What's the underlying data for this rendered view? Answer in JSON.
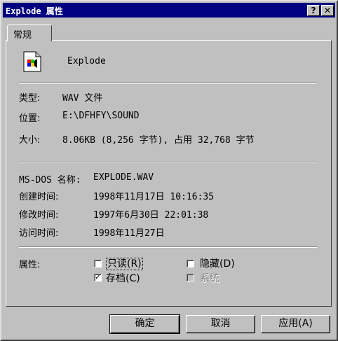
{
  "window": {
    "title": "Explode 属性",
    "help_button": "?",
    "close_button": "✕"
  },
  "tabs": [
    {
      "label": "常规",
      "selected": true
    }
  ],
  "file": {
    "name": "Explode",
    "icon": "sound-file-icon"
  },
  "info": {
    "type_label": "类型:",
    "type_value": "WAV 文件",
    "location_label": "位置:",
    "location_value": "E:\\DFHFY\\SOUND",
    "size_label": "大小:",
    "size_value": "8.06KB (8,256 字节), 占用 32,768 字节"
  },
  "dates": {
    "msdos_label": "MS-DOS 名称:",
    "msdos_value": "EXPLODE.WAV",
    "created_label": "创建时间:",
    "created_value": "1998年11月17日 10:16:35",
    "modified_label": "修改时间:",
    "modified_value": "1997年6月30日 22:01:38",
    "accessed_label": "访问时间:",
    "accessed_value": "1998年11月27日"
  },
  "attributes": {
    "label": "属性:",
    "readonly": {
      "label": "只读(R)",
      "checked": false
    },
    "hidden": {
      "label": "隐藏(D)",
      "checked": false
    },
    "archive": {
      "label": "存档(C)",
      "checked": true
    },
    "system": {
      "label": "系统",
      "checked": false,
      "disabled": true
    }
  },
  "buttons": {
    "ok": "确定",
    "cancel": "取消",
    "apply": "应用(A)"
  },
  "colors": {
    "titlebar": "#000080",
    "face": "#c0c0c0"
  }
}
